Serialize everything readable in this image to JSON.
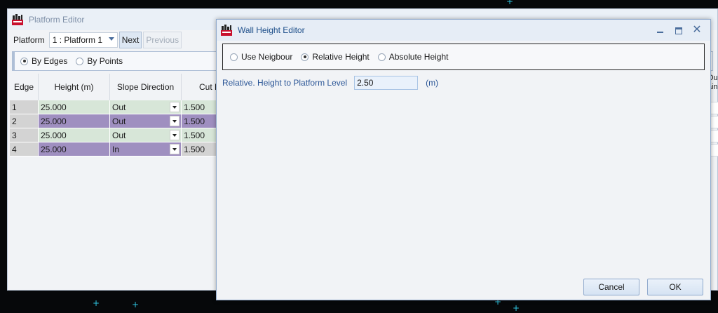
{
  "platform_editor": {
    "title": "Platform Editor",
    "platform_label": "Platform",
    "platform_value": "1 : Platform 1",
    "next_label": "Next",
    "previous_label": "Previous",
    "modes": [
      "By Edges",
      "By Points"
    ],
    "selected_mode": "By Edges",
    "columns": [
      "Edge",
      "Height (m)",
      "Slope Direction",
      "Cut F"
    ],
    "right_header_partial": "Ou\nain",
    "rows": [
      {
        "edge": "1",
        "height": "25.000",
        "slope": "Out",
        "cut": "1.500"
      },
      {
        "edge": "2",
        "height": "25.000",
        "slope": "Out",
        "cut": "1.500"
      },
      {
        "edge": "3",
        "height": "25.000",
        "slope": "Out",
        "cut": "1.500"
      },
      {
        "edge": "4",
        "height": "25.000",
        "slope": "In",
        "cut": "1.500"
      }
    ]
  },
  "wall_height_editor": {
    "title": "Wall Height Editor",
    "options": [
      "Use Neigbour",
      "Relative Height",
      "Absolute Height"
    ],
    "selected_option": "Relative Height",
    "field_label": "Relative. Height to Platform Level",
    "field_value": "2.50",
    "field_unit": "(m)",
    "cancel_label": "Cancel",
    "ok_label": "OK"
  },
  "colors": {
    "row_light": "#d7e6d8",
    "row_dark": "#9f8fc0",
    "accent": "#2a5596"
  }
}
